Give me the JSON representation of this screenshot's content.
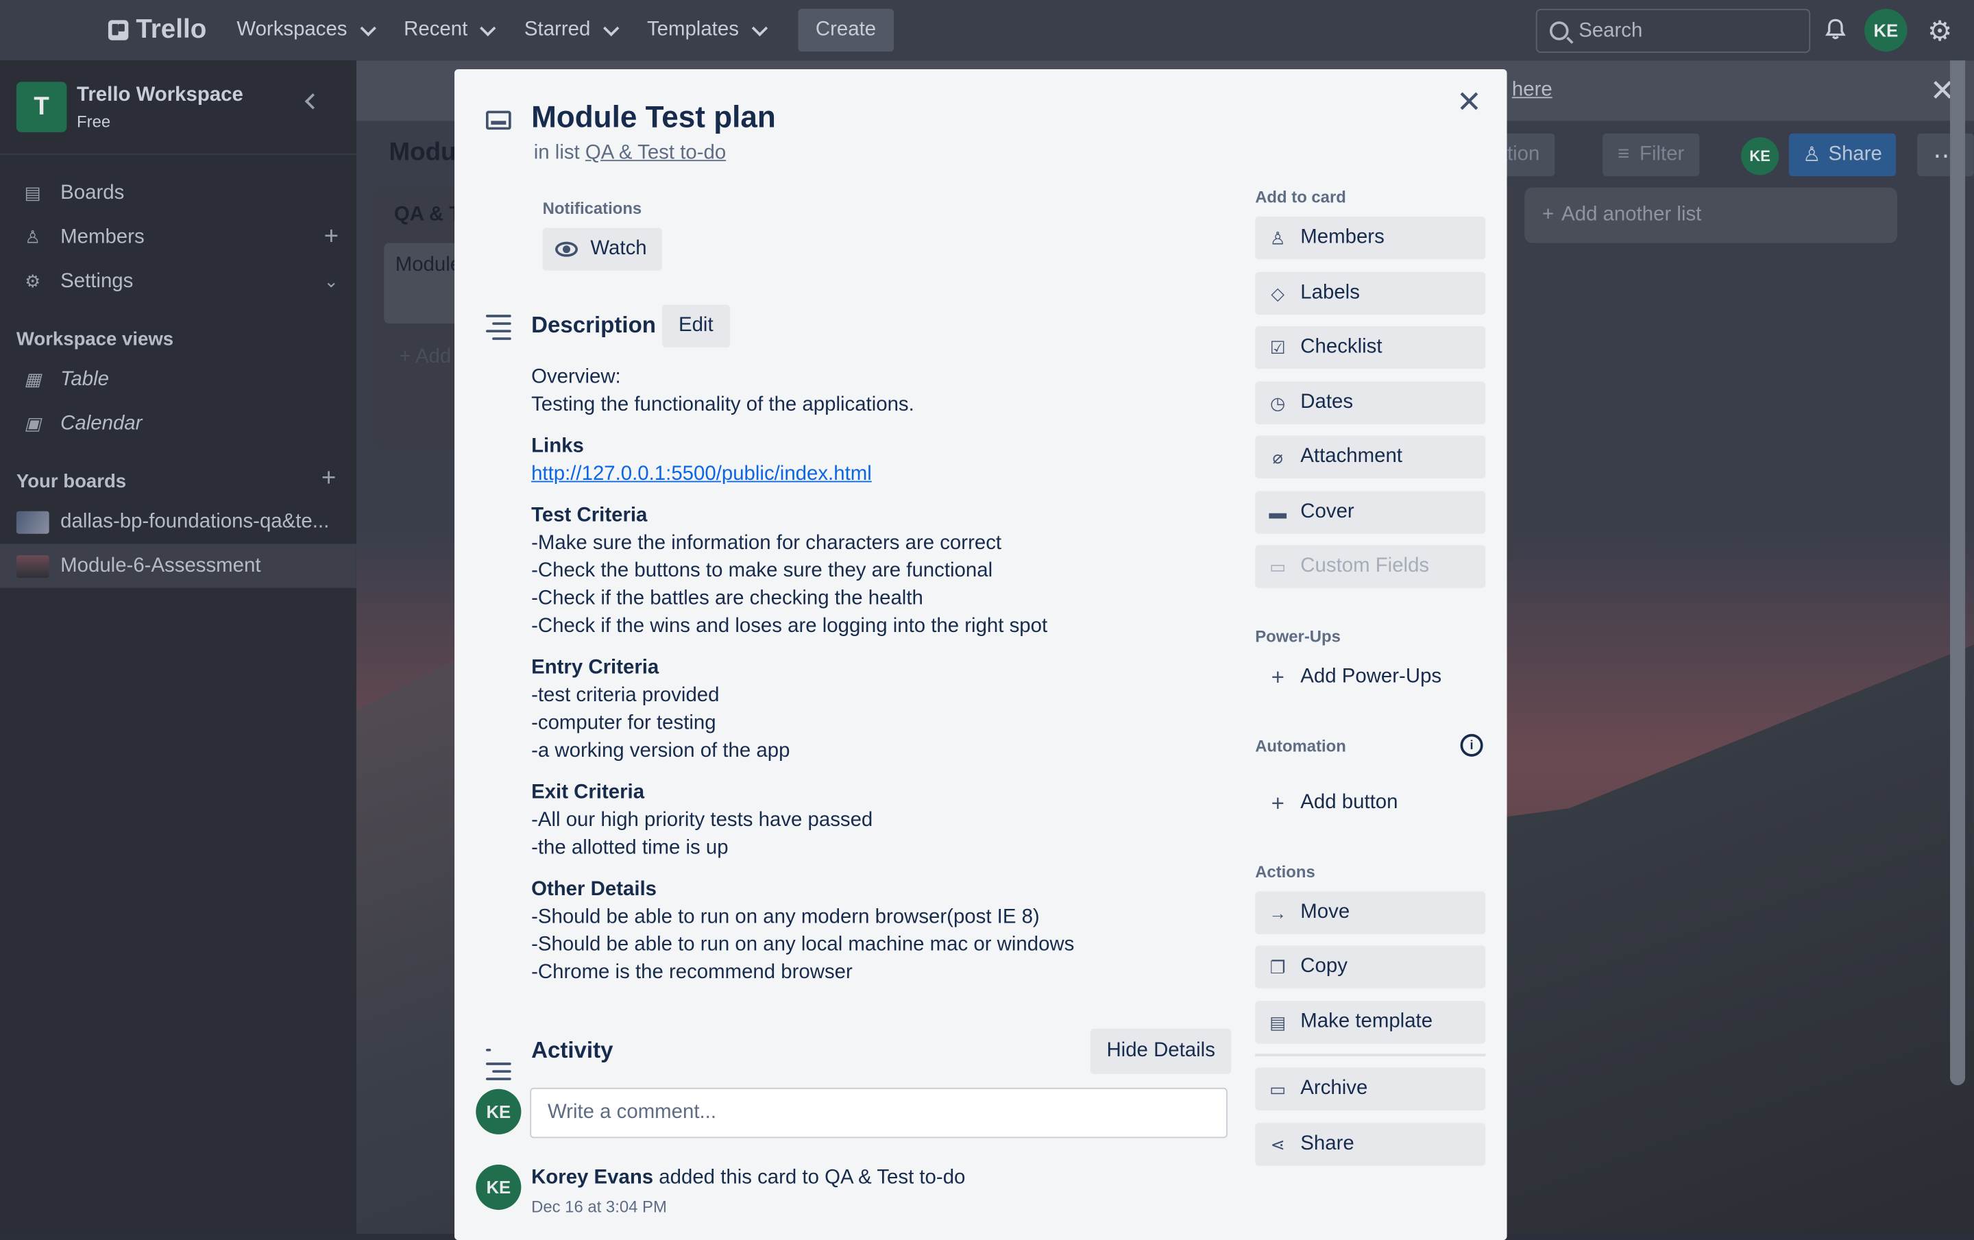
{
  "header": {
    "brand": "Trello",
    "nav": [
      "Workspaces",
      "Recent",
      "Starred",
      "Templates"
    ],
    "create_label": "Create",
    "search_placeholder": "Search",
    "user_initials": "KE"
  },
  "sidebar": {
    "workspace_name": "Trello Workspace",
    "workspace_badge": "T",
    "workspace_plan": "Free",
    "items": [
      {
        "label": "Boards",
        "icon": "board-icon"
      },
      {
        "label": "Members",
        "icon": "person-icon"
      },
      {
        "label": "Settings",
        "icon": "gear-icon"
      }
    ],
    "views_heading": "Workspace views",
    "views": [
      {
        "label": "Table",
        "icon": "table-icon"
      },
      {
        "label": "Calendar",
        "icon": "calendar-icon"
      }
    ],
    "boards_heading": "Your boards",
    "boards": [
      {
        "label": "dallas-bp-foundations-qa&te...",
        "active": false
      },
      {
        "label": "Module-6-Assessment",
        "active": true
      }
    ]
  },
  "board": {
    "banner_link": "here",
    "title": "Modul",
    "automation_label": "mation",
    "filter_label": "Filter",
    "share_label": "Share",
    "list_title": "QA & T",
    "list_card": "Module",
    "list_add": "Add",
    "add_list": "Add another list",
    "member_initials": "KE"
  },
  "card": {
    "title": "Module Test plan",
    "in_list_prefix": "in list",
    "list_name": "QA & Test to-do",
    "notifications_label": "Notifications",
    "watch_label": "Watch",
    "description_heading": "Description",
    "edit_label": "Edit",
    "description": {
      "overview_label": "Overview:",
      "overview_text": "Testing the functionality of the applications.",
      "links_heading": "Links",
      "link": "http://127.0.0.1:5500/public/index.html",
      "test_heading": "Test Criteria",
      "test_items": [
        "-Make sure the information for characters are correct",
        "-Check the buttons to make sure they are functional",
        "-Check if the battles are checking the health",
        "-Check if the wins and loses are logging into the right spot"
      ],
      "entry_heading": "Entry Criteria",
      "entry_items": [
        "-test criteria provided",
        "-computer for testing",
        "-a working version of the app"
      ],
      "exit_heading": "Exit Criteria",
      "exit_items": [
        "-All our high priority tests have passed",
        "-the allotted time is up"
      ],
      "other_heading": "Other Details",
      "other_items": [
        "-Should be able to run on any modern browser(post IE 8)",
        "-Should be able to run on any local machine mac or windows",
        "-Chrome is the recommend browser"
      ]
    },
    "activity_heading": "Activity",
    "hide_details_label": "Hide Details",
    "comment_placeholder": "Write a comment...",
    "activity_user": "Korey Evans",
    "activity_action": "added this card to QA & Test to-do",
    "activity_time": "Dec 16 at 3:04 PM",
    "user_initials": "KE"
  },
  "card_sidebar": {
    "add_heading": "Add to card",
    "add_items": [
      {
        "label": "Members",
        "icon": "person-icon"
      },
      {
        "label": "Labels",
        "icon": "tag-icon"
      },
      {
        "label": "Checklist",
        "icon": "checklist-icon"
      },
      {
        "label": "Dates",
        "icon": "clock-icon"
      },
      {
        "label": "Attachment",
        "icon": "paperclip-icon"
      },
      {
        "label": "Cover",
        "icon": "cover-icon"
      },
      {
        "label": "Custom Fields",
        "icon": "custom-fields-icon",
        "disabled": true
      }
    ],
    "powerups_heading": "Power-Ups",
    "add_powerups": "Add Power-Ups",
    "automation_heading": "Automation",
    "add_button": "Add button",
    "actions_heading": "Actions",
    "actions": [
      {
        "label": "Move",
        "icon": "arrow-right-icon"
      },
      {
        "label": "Copy",
        "icon": "copy-icon"
      },
      {
        "label": "Make template",
        "icon": "template-icon"
      },
      {
        "label": "Archive",
        "icon": "archive-icon"
      },
      {
        "label": "Share",
        "icon": "share-icon"
      }
    ]
  }
}
